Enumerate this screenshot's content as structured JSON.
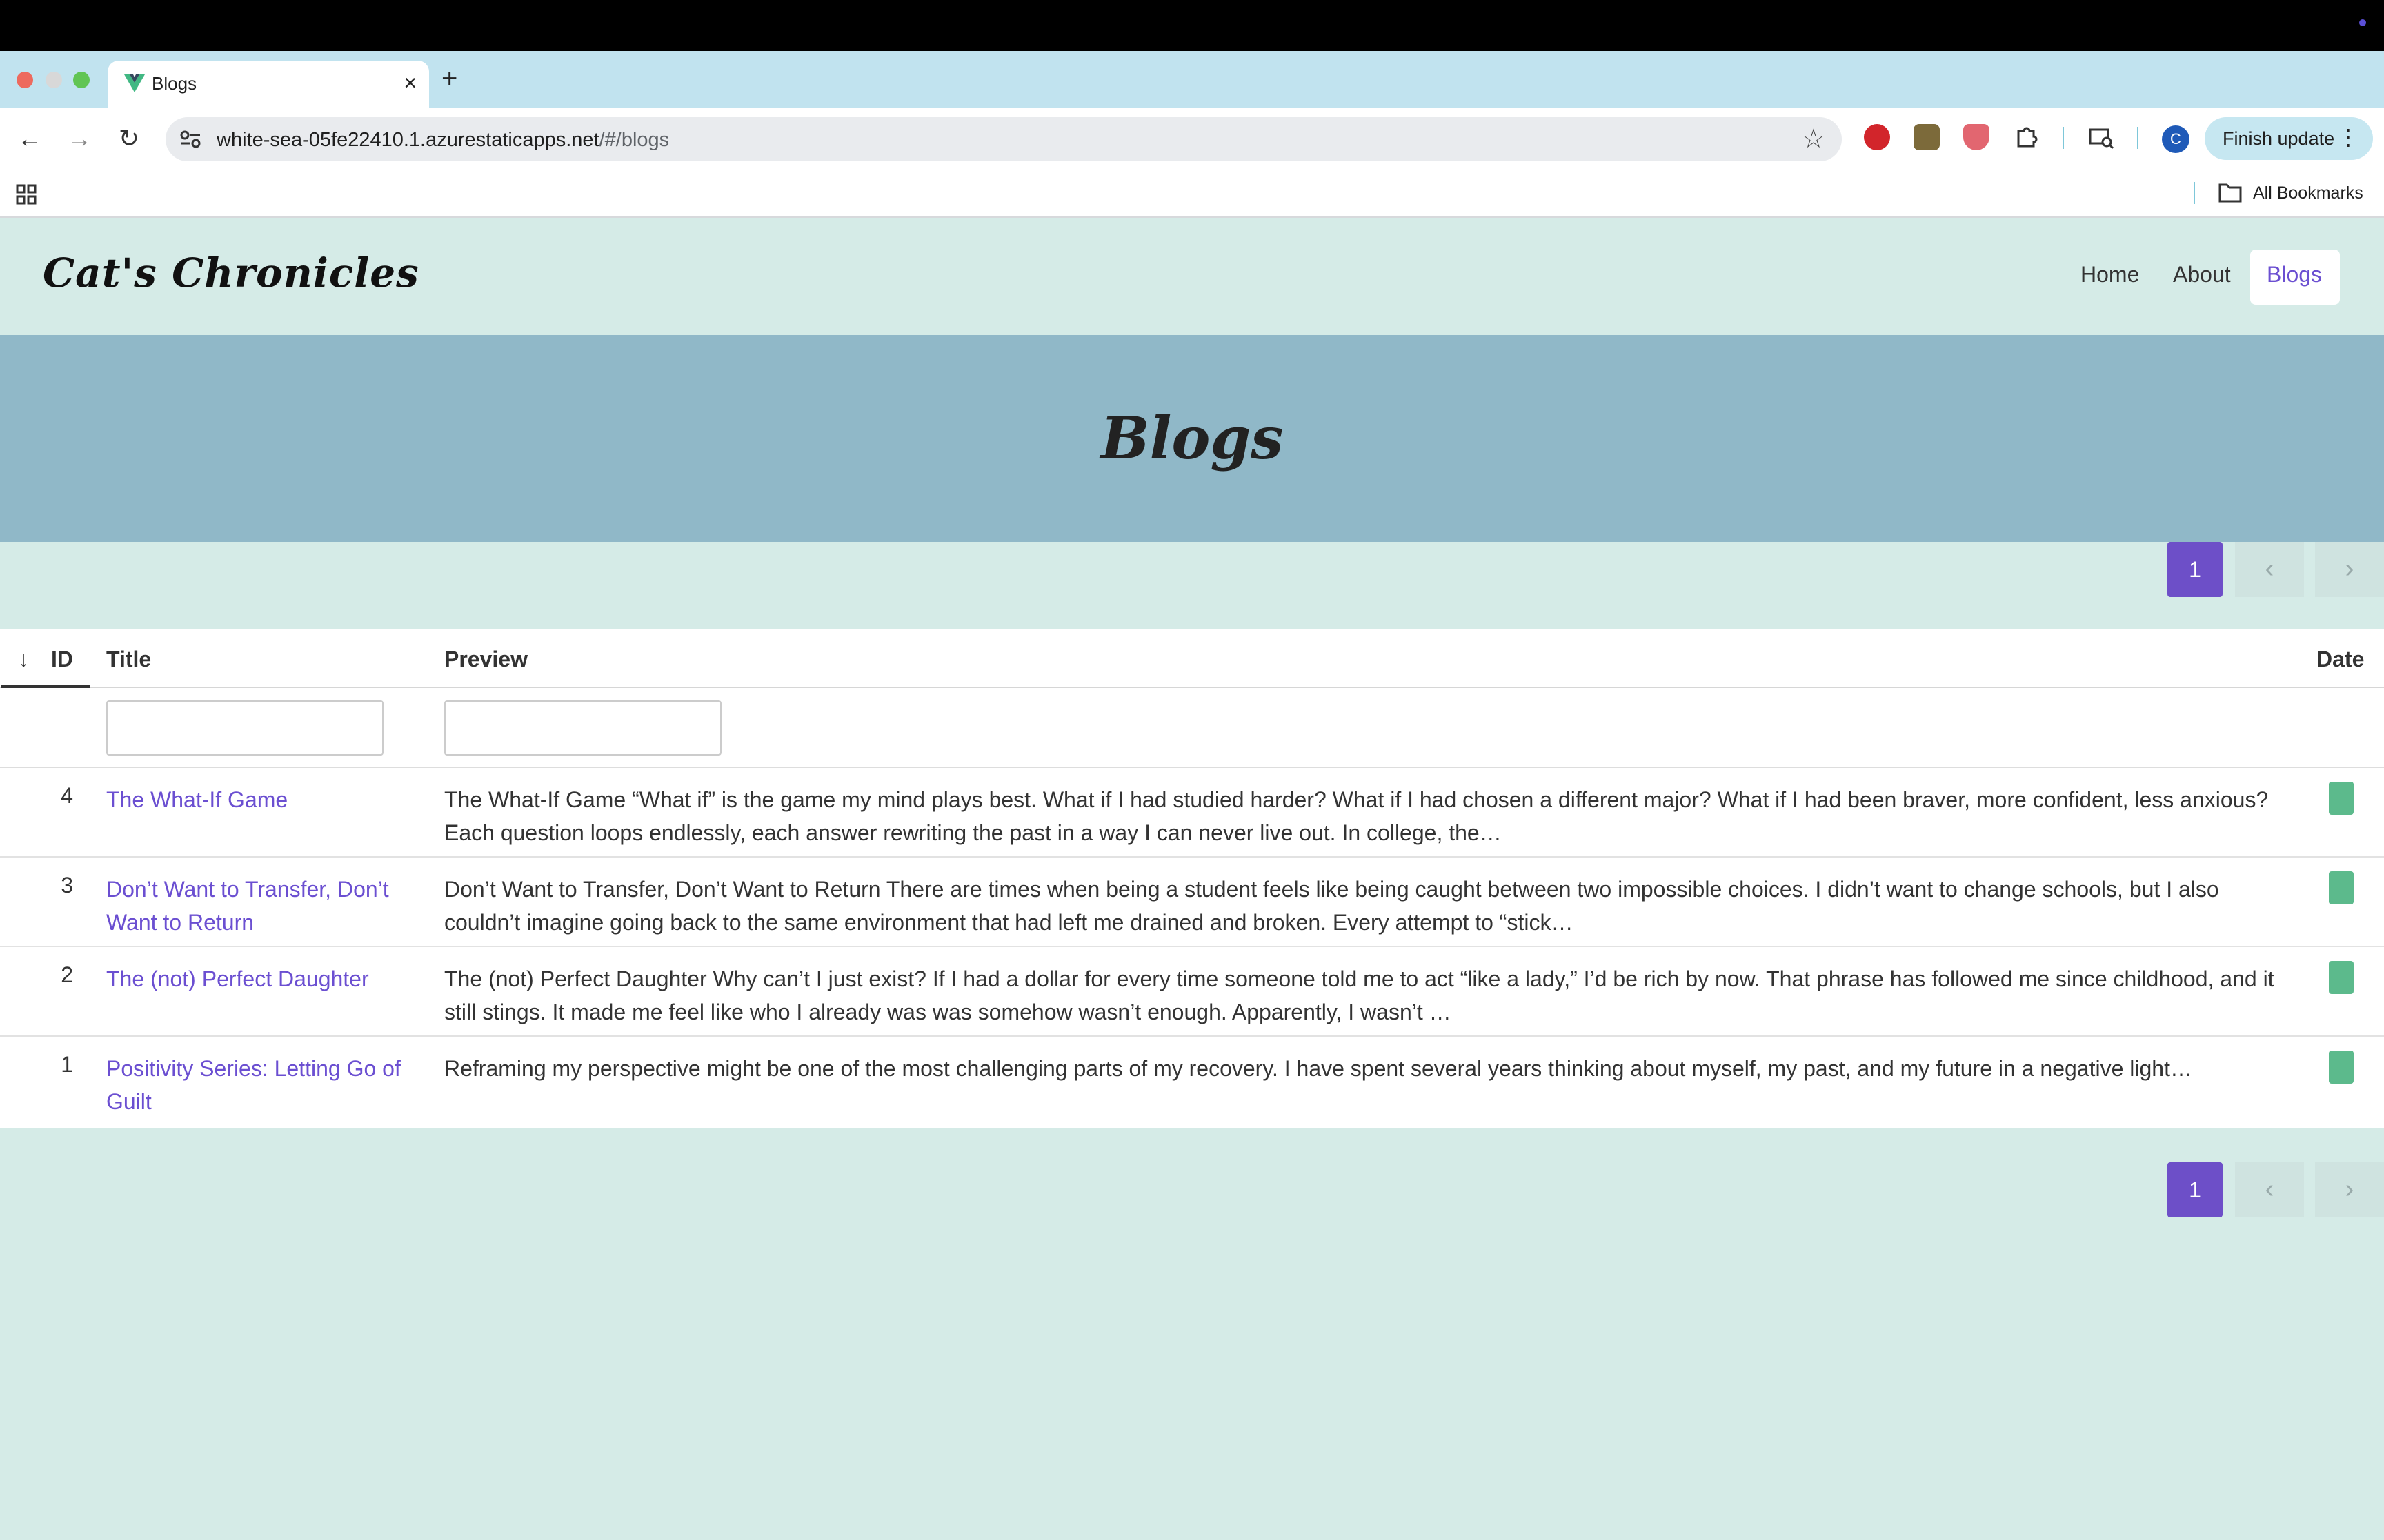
{
  "browser": {
    "tab_title": "Blogs",
    "url_host": "white-sea-05fe22410.1.azurestaticapps.net",
    "url_path": "/#/blogs",
    "update_label": "Finish update",
    "profile_initial": "C",
    "bookmarks_label": "All Bookmarks",
    "icons": [
      "back-icon",
      "forward-icon",
      "reload-icon",
      "site-settings-icon",
      "star-icon",
      "extensions-icon",
      "apps-icon",
      "folder-icon"
    ]
  },
  "site": {
    "logo": "Cat's Chronicles",
    "nav": [
      {
        "label": "Home"
      },
      {
        "label": "About"
      },
      {
        "label": "Blogs",
        "active": true
      }
    ],
    "hero_title": "Blogs"
  },
  "pagination": {
    "current_page": "1",
    "prev_icon": "‹",
    "next_icon": "›"
  },
  "table": {
    "columns": {
      "sort_icon": "↓",
      "id": "ID",
      "title": "Title",
      "preview": "Preview",
      "date": "Date"
    },
    "rows": [
      {
        "id": "4",
        "title": "The What-If Game",
        "preview": "The What-If Game “What if” is the game my mind plays best. What if I had studied harder? What if I had chosen a different major? What if I had been braver, more confident, less anxious? Each question loops endlessly, each answer rewriting the past in a way I can never live out. In college, the…"
      },
      {
        "id": "3",
        "title": "Don’t Want to Transfer, Don’t Want to Return",
        "preview": "Don’t Want to Transfer, Don’t Want to Return There are times when being a student feels like being caught between two impossible choices. I didn’t want to change schools, but I also couldn’t imagine going back to the same environment that had left me drained and broken. Every attempt to “stick…"
      },
      {
        "id": "2",
        "title": "The (not) Perfect Daughter",
        "preview": "The (not) Perfect Daughter Why can’t I just exist? If I had a dollar for every time someone told me to act “like a lady,” I’d be rich by now. That phrase has followed me since childhood, and it still stings. It made me feel like who I already was was somehow wasn’t enough. Apparently, I wasn’t …"
      },
      {
        "id": "1",
        "title": "Positivity Series: Letting Go of Guilt",
        "preview": "Reframing my perspective might be one of the most challenging parts of my recovery. I have spent several years thinking about myself, my past, and my future in a negative light…"
      }
    ]
  },
  "colors": {
    "accent": "#6b4fd1",
    "page_bg": "#d5ebe7",
    "hero_bg": "#90b8c8",
    "date_badge": "#5cba8c"
  }
}
